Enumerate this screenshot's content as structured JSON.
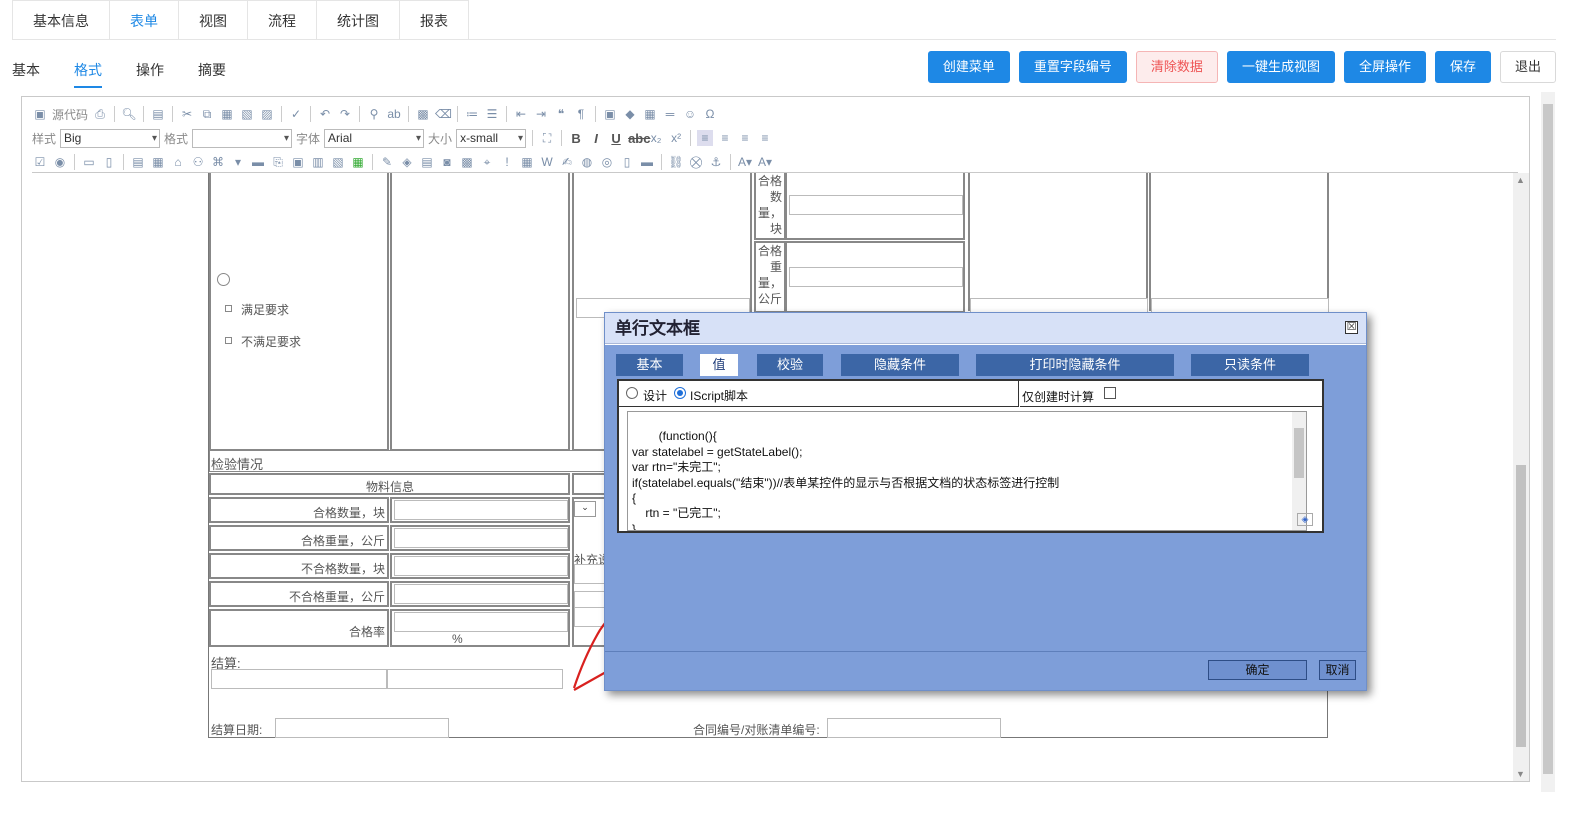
{
  "top_tabs": [
    "基本信息",
    "表单",
    "视图",
    "流程",
    "统计图",
    "报表"
  ],
  "sub_tabs": [
    "基本",
    "格式",
    "操作",
    "摘要"
  ],
  "actions": {
    "create_menu": "创建菜单",
    "reset_field_no": "重置字段编号",
    "clear_data": "清除数据",
    "gen_view": "一键生成视图",
    "fullscreen": "全屏操作",
    "save": "保存",
    "exit": "退出"
  },
  "toolbar": {
    "source": "源代码",
    "style_label": "样式",
    "style_value": "Big",
    "format_label": "格式",
    "format_value": "",
    "font_label": "字体",
    "font_value": "Arial",
    "size_label": "大小",
    "size_value": "x-small"
  },
  "form": {
    "radio_option_1": "满足要求",
    "radio_option_2": "不满足要求",
    "v_label_1": "合格数量，块",
    "v_label_2": "合格重量，公斤",
    "inspection": "检验情况",
    "material_info": "物料信息",
    "rows": [
      "合格数量，块",
      "合格重量，公斤",
      "不合格数量，块",
      "不合格重量，公斤",
      "合格率"
    ],
    "percent": "%",
    "supplement": "补充说",
    "settlement": "结算:",
    "settlement_date": "结算日期:",
    "contract_no": "合同编号/对账清单编号:"
  },
  "dialog": {
    "title": "单行文本框",
    "close": "☒",
    "tabs": [
      "基本",
      "值",
      "校验",
      "隐藏条件",
      "打印时隐藏条件",
      "只读条件"
    ],
    "radio_design": "设计",
    "radio_script": "IScript脚本",
    "calc_on_create": "仅创建时计算",
    "code": "(function(){\nvar statelabel = getStateLabel();\nvar rtn=\"未完工\";\nif(statelabel.equals(\"结束\"))//表单某控件的显示与否根据文档的状态标签进行控制\n{\n    rtn = \"已完工\";\n}\nreturn rtn;",
    "ok": "确定",
    "cancel": "取消"
  }
}
